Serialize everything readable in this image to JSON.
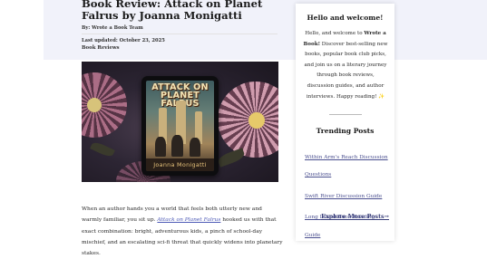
{
  "article": {
    "title": "Book Review: Attack on Planet Falrus by Joanna Monigatti",
    "byline": "By: Wrote a Book Team",
    "updated": "Last updated: October 23, 2025",
    "category": "Book Reviews",
    "cover": {
      "title": "ATTACK ON PLANET FALRUS",
      "author": "Joanna Monigatti"
    },
    "body": {
      "before_link": "When an author hands you a world that feels both utterly new and warmly familiar, you sit up. ",
      "link_text": "Attack on Planet Falrus",
      "after_link": " hooked us with that exact combination: bright, adventurous kids, a pinch of school-day mischief, and an escalating sci-fi threat that quickly widens into planetary stakes."
    }
  },
  "sidebar": {
    "welcome_heading": "Hello and welcome!",
    "welcome_intro": "Hello, and welcome to ",
    "welcome_brand": "Wrote a Book!",
    "welcome_rest": " Discover best-selling new books, popular book club picks, and join us on a literary journey through book reviews, discussion guides, and author interviews. Happy reading! ✨",
    "trending_heading": "Trending Posts",
    "trending": [
      "Within Arm's Reach Discussion Questions",
      "Swift River Discussion Guide",
      "Long Island Book Reading Guide"
    ],
    "explore_label": "Explore More Posts→"
  },
  "colors": {
    "header_band": "#f1f2fa",
    "link": "#4a57b5",
    "sidebar_link": "#4a4f8f"
  }
}
